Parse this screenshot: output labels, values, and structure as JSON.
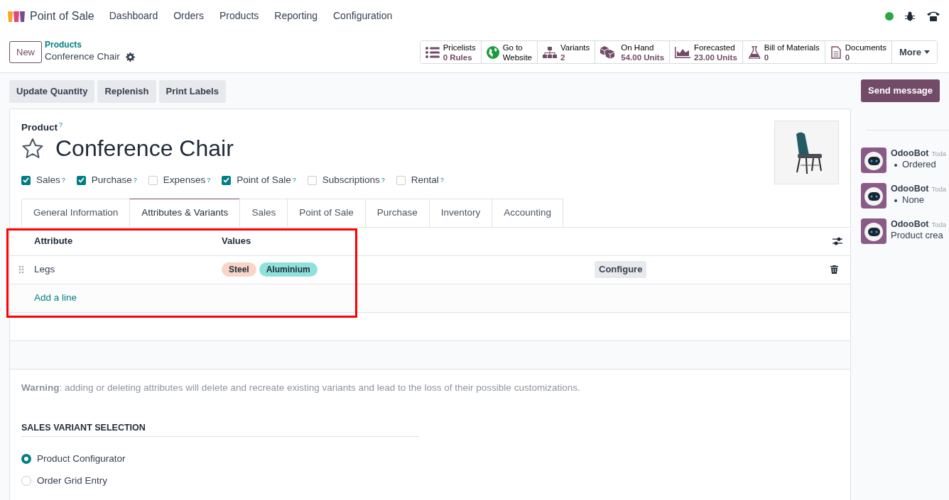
{
  "app": {
    "name": "Point of Sale"
  },
  "menu": [
    "Dashboard",
    "Orders",
    "Products",
    "Reporting",
    "Configuration"
  ],
  "new_button": "New",
  "breadcrumb": {
    "parent": "Products",
    "current": "Conference Chair"
  },
  "smart_buttons": [
    {
      "label": "Pricelists",
      "value": "0 Rules",
      "kind": "stat"
    },
    {
      "label": "Go to",
      "value": "Website",
      "kind": "link"
    },
    {
      "label": "Variants",
      "value": "2",
      "kind": "stat"
    },
    {
      "label": "On Hand",
      "value": "54.00 Units",
      "kind": "stat"
    },
    {
      "label": "Forecasted",
      "value": "23.00 Units",
      "kind": "stat"
    },
    {
      "label": "Bill of Materials",
      "value": "0",
      "kind": "stat"
    },
    {
      "label": "Documents",
      "value": "0",
      "kind": "stat"
    }
  ],
  "more_button": "More",
  "actions": [
    "Update Quantity",
    "Replenish",
    "Print Labels"
  ],
  "send_message": "Send message",
  "form": {
    "field_label": "Product",
    "field_help": "?",
    "favorite": false,
    "name": "Conference Chair",
    "flags": [
      {
        "label": "Sales",
        "help": "?",
        "checked": true
      },
      {
        "label": "Purchase",
        "help": "?",
        "checked": true
      },
      {
        "label": "Expenses",
        "help": "?",
        "checked": false
      },
      {
        "label": "Point of Sale",
        "help": "?",
        "checked": true
      },
      {
        "label": "Subscriptions",
        "help": "?",
        "checked": false
      },
      {
        "label": "Rental",
        "help": "?",
        "checked": false
      }
    ],
    "tabs": [
      {
        "label": "General Information",
        "selected": false
      },
      {
        "label": "Attributes & Variants",
        "selected": true
      },
      {
        "label": "Sales",
        "selected": false
      },
      {
        "label": "Point of Sale",
        "selected": false
      },
      {
        "label": "Purchase",
        "selected": false
      },
      {
        "label": "Inventory",
        "selected": false
      },
      {
        "label": "Accounting",
        "selected": false
      }
    ],
    "attributes": {
      "highlighted": true,
      "columns": [
        "Attribute",
        "Values"
      ],
      "rows": [
        {
          "attribute": "Legs",
          "values": [
            {
              "label": "Steel",
              "color": "#f8d5c8"
            },
            {
              "label": "Aluminium",
              "color": "#8fe1db"
            }
          ],
          "action": "Configure"
        }
      ],
      "add_line": "Add a line"
    },
    "warning": "**Warning**: adding or deleting attributes will delete and recreate existing variants and lead to the loss of their possible customizations.",
    "section_title": "SALES VARIANT SELECTION",
    "options": [
      {
        "label": "Product Configurator",
        "selected": true
      },
      {
        "label": "Order Grid Entry",
        "selected": false
      }
    ]
  },
  "chatter": {
    "messages": [
      {
        "author": "OdooBot",
        "time": "Toda",
        "kind": "bullet",
        "body": "Ordered"
      },
      {
        "author": "OdooBot",
        "time": "Toda",
        "kind": "bullet",
        "body": "None"
      },
      {
        "author": "OdooBot",
        "time": "Toda",
        "kind": "text",
        "body": "Product crea"
      }
    ]
  }
}
